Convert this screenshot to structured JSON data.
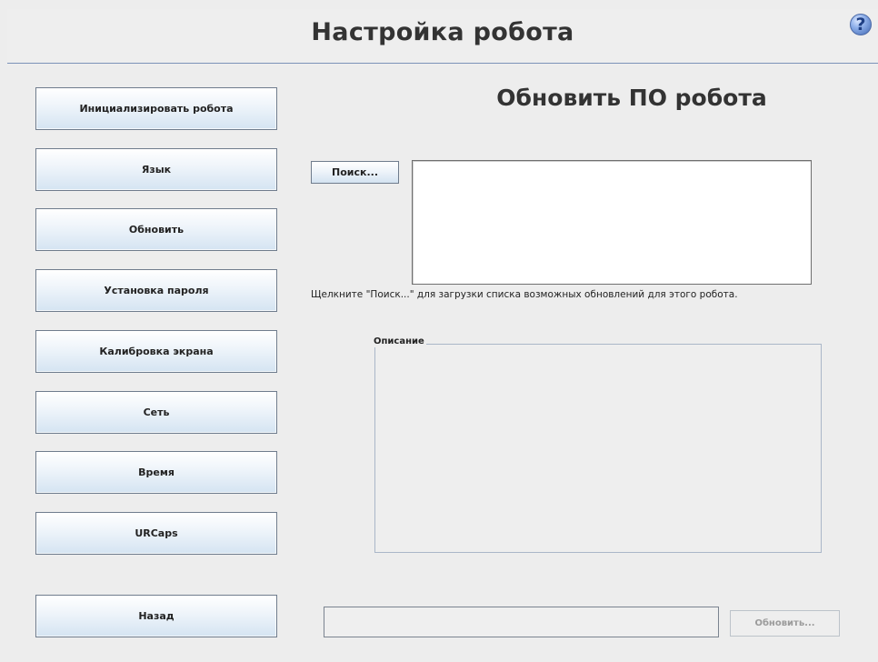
{
  "header": {
    "title": "Настройка робота",
    "help_icon": "?"
  },
  "sidebar": {
    "items": [
      {
        "label": "Инициализировать робота"
      },
      {
        "label": "Язык"
      },
      {
        "label": "Обновить"
      },
      {
        "label": "Установка пароля"
      },
      {
        "label": "Калибровка экрана"
      },
      {
        "label": "Сеть"
      },
      {
        "label": "Время"
      },
      {
        "label": "URCaps"
      }
    ],
    "back_label": "Назад"
  },
  "main": {
    "title": "Обновить ПО робота",
    "search_label": "Поиск...",
    "hint": "Щелкните \"Поиск...\" для загрузки списка возможных обновлений для этого робота.",
    "description_label": "Описание",
    "path_value": "",
    "update_label": "Обновить..."
  },
  "colors": {
    "background": "#ededed",
    "header_line": "#7c93b8",
    "button_gradient_end": "#d5e4f2",
    "help_icon_blue": "#3f67b2"
  }
}
